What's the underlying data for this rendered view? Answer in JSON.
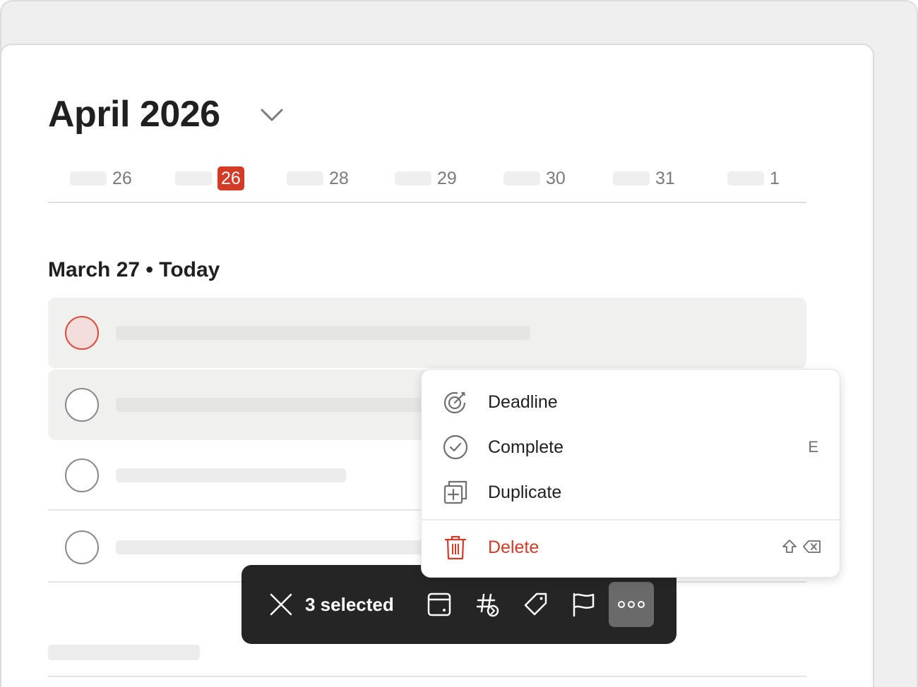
{
  "calendar": {
    "month_title": "April 2026",
    "week_days": [
      {
        "num": "26",
        "current": false
      },
      {
        "num": "26",
        "current": true
      },
      {
        "num": "28",
        "current": false
      },
      {
        "num": "29",
        "current": false
      },
      {
        "num": "30",
        "current": false
      },
      {
        "num": "31",
        "current": false
      },
      {
        "num": "1",
        "current": false
      }
    ]
  },
  "section": {
    "title": "March 27 • Today"
  },
  "toolbar": {
    "selected_label": "3 selected"
  },
  "context_menu": {
    "items": [
      {
        "label": "Deadline",
        "icon": "deadline-icon",
        "shortcut": ""
      },
      {
        "label": "Complete",
        "icon": "complete-check-icon",
        "shortcut": "E"
      },
      {
        "label": "Duplicate",
        "icon": "duplicate-icon",
        "shortcut": ""
      }
    ],
    "delete": {
      "label": "Delete",
      "icon": "trash-icon",
      "shortcut_icons": [
        "shift-icon",
        "backspace-icon"
      ]
    }
  },
  "colors": {
    "accent_red": "#d43b27",
    "toolbar_bg": "#252525",
    "selected_row_bg": "#f0f0ef"
  }
}
